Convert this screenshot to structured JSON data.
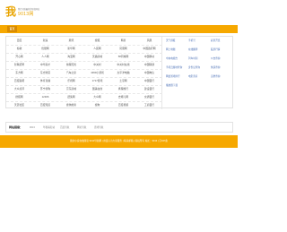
{
  "header": {
    "logo_char": "我",
    "slogan": "我们只做最好的导航网站",
    "site_name": "9013网"
  },
  "nav": {
    "home_tab": "首页"
  },
  "grid": {
    "rows": [
      [
        "百度",
        "新浪",
        "腾讯",
        "搜狐",
        "网易",
        "凤凰"
      ],
      [
        "谷歌",
        "优酷网",
        "新华网",
        "人民网",
        "凤凰网",
        "中国政府网"
      ],
      [
        "开心网",
        "人人网",
        "淘宝网",
        "天猫商城",
        "58同城网",
        "中国移动"
      ],
      [
        "智联招聘",
        "中华英才",
        "前程无忧",
        "中关村",
        "中关村在线",
        "中国联通"
      ],
      [
        "东方网",
        "东方财富",
        "汽车之家",
        "4399小游戏",
        "太平洋电脑",
        "中国电信"
      ],
      [
        "百度贴吧",
        "体育直播",
        "乐视网",
        "1717游戏",
        "土豆网",
        "中国银行"
      ],
      [
        "大众点评",
        "苏宁易购",
        "京东商城",
        "国美在线",
        "携程旅行",
        "建设银行"
      ],
      [
        "搜狐网",
        "12306",
        "赶集网",
        "大众网",
        "去哪儿网",
        "交通银行"
      ],
      [
        "天涯社区",
        "百度知道",
        "搜狗搜索",
        "搜狗",
        "百度视频",
        "工商银行"
      ]
    ]
  },
  "side": {
    "rows": [
      [
        "天气预报",
        "手机号",
        "彩票开奖"
      ],
      [
        "网上地图",
        "在线翻译",
        "股票行情"
      ],
      [
        "中央电视台",
        "列车时刻",
        "公交查询"
      ],
      [
        "手机归属地查询",
        "身份证查询",
        "快递查询"
      ],
      [
        "网络游戏排行",
        "电影票房",
        "违章查询"
      ],
      [
        "播放器下载"
      ]
    ]
  },
  "links": {
    "label": "网站链接：",
    "items": [
      "9013",
      "华视看名站",
      "百度导航",
      "网址导航",
      "游戏导航"
    ]
  },
  "footer": {
    "text": "我的小说在线阅读 9013导航网 | 用爱心为大家服务 | 联系邮箱 | 版权所有 站长：9013 | 京ICP备"
  }
}
